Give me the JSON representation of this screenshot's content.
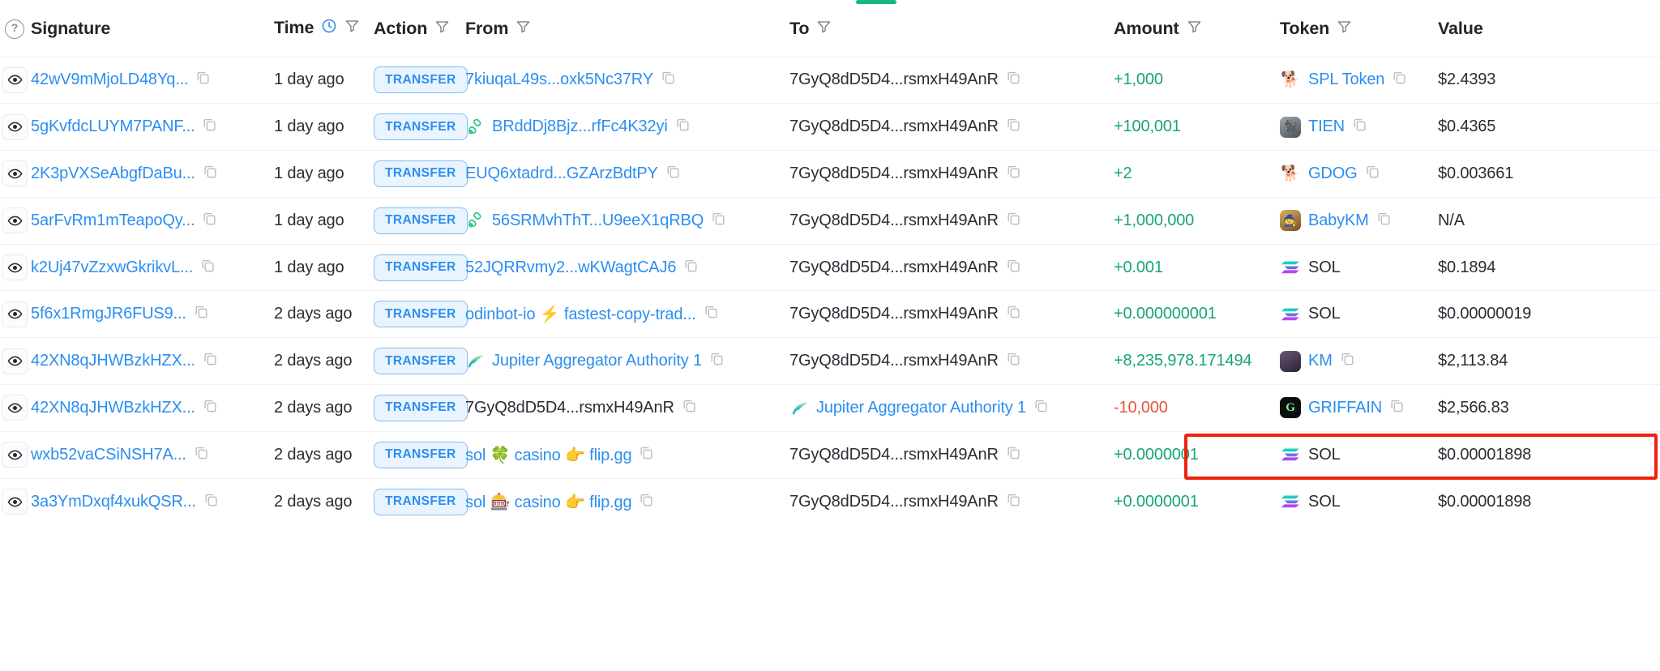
{
  "table": {
    "columns": [
      {
        "key": "eye",
        "label": "",
        "icon": "help-circle-icon",
        "filter": false
      },
      {
        "key": "signature",
        "label": "Signature",
        "filter": false
      },
      {
        "key": "time",
        "label": "Time",
        "icon": "clock-icon",
        "filter": true
      },
      {
        "key": "action",
        "label": "Action",
        "filter": true
      },
      {
        "key": "from",
        "label": "From",
        "filter": true
      },
      {
        "key": "to",
        "label": "To",
        "filter": true
      },
      {
        "key": "amount",
        "label": "Amount",
        "filter": true
      },
      {
        "key": "token",
        "label": "Token",
        "filter": true
      },
      {
        "key": "value",
        "label": "Value",
        "filter": false
      }
    ],
    "rows": [
      {
        "signature": "42wV9mMjoLD48Yq...",
        "time": "1 day ago",
        "action": "TRANSFER",
        "from": {
          "label": "7kiuqaL49s...oxk5Nc37RY",
          "link": true,
          "icon": "none",
          "copy": true
        },
        "to": {
          "label": "7GyQ8dD5D4...rsmxH49AnR",
          "link": false,
          "icon": "none",
          "copy": true
        },
        "amount": "+1,000",
        "amount_sign": "positive",
        "token": {
          "label": "SPL Token",
          "icon": "dog-emoji",
          "copy": true
        },
        "value": "$2.4393"
      },
      {
        "signature": "5gKvfdcLUYM7PANF...",
        "time": "1 day ago",
        "action": "TRANSFER",
        "from": {
          "label": "BRddDj8Bjz...rfFc4K32yi",
          "link": true,
          "icon": "pump-icon",
          "copy": true
        },
        "to": {
          "label": "7GyQ8dD5D4...rsmxH49AnR",
          "link": false,
          "icon": "none",
          "copy": true
        },
        "amount": "+100,001",
        "amount_sign": "positive",
        "token": {
          "label": "TIEN",
          "icon": "tien-avatar",
          "copy": true
        },
        "value": "$0.4365"
      },
      {
        "signature": "2K3pVXSeAbgfDaBu...",
        "time": "1 day ago",
        "action": "TRANSFER",
        "from": {
          "label": "EUQ6xtadrd...GZArzBdtPY",
          "link": true,
          "icon": "none",
          "copy": true
        },
        "to": {
          "label": "7GyQ8dD5D4...rsmxH49AnR",
          "link": false,
          "icon": "none",
          "copy": true
        },
        "amount": "+2",
        "amount_sign": "positive",
        "token": {
          "label": "GDOG",
          "icon": "puppy-emoji",
          "copy": true
        },
        "value": "$0.003661"
      },
      {
        "signature": "5arFvRm1mTeapoQy...",
        "time": "1 day ago",
        "action": "TRANSFER",
        "from": {
          "label": "56SRMvhThT...U9eeX1qRBQ",
          "link": true,
          "icon": "pump-icon",
          "copy": true
        },
        "to": {
          "label": "7GyQ8dD5D4...rsmxH49AnR",
          "link": false,
          "icon": "none",
          "copy": true
        },
        "amount": "+1,000,000",
        "amount_sign": "positive",
        "token": {
          "label": "BabyKM",
          "icon": "babykm-avatar",
          "copy": true
        },
        "value": "N/A"
      },
      {
        "signature": "k2Uj47vZzxwGkrikvL...",
        "time": "1 day ago",
        "action": "TRANSFER",
        "from": {
          "label": "52JQRRvmy2...wKWagtCAJ6",
          "link": true,
          "icon": "none",
          "copy": true
        },
        "to": {
          "label": "7GyQ8dD5D4...rsmxH49AnR",
          "link": false,
          "icon": "none",
          "copy": true
        },
        "amount": "+0.001",
        "amount_sign": "positive",
        "token": {
          "label": "SOL",
          "icon": "solana-logo",
          "copy": false
        },
        "value": "$0.1894"
      },
      {
        "signature": "5f6x1RmgJR6FUS9...",
        "time": "2 days ago",
        "action": "TRANSFER",
        "from": {
          "label": "odinbot-io ⚡ fastest-copy-trad...",
          "link": true,
          "icon": "none",
          "copy": true
        },
        "to": {
          "label": "7GyQ8dD5D4...rsmxH49AnR",
          "link": false,
          "icon": "none",
          "copy": true
        },
        "amount": "+0.000000001",
        "amount_sign": "positive",
        "token": {
          "label": "SOL",
          "icon": "solana-logo",
          "copy": false
        },
        "value": "$0.00000019"
      },
      {
        "signature": "42XN8qJHWBzkHZX...",
        "time": "2 days ago",
        "action": "TRANSFER",
        "from": {
          "label": "Jupiter Aggregator Authority 1",
          "link": true,
          "icon": "jupiter-logo",
          "copy": true
        },
        "to": {
          "label": "7GyQ8dD5D4...rsmxH49AnR",
          "link": false,
          "icon": "none",
          "copy": true
        },
        "amount": "+8,235,978.171494",
        "amount_sign": "positive",
        "token": {
          "label": "KM",
          "icon": "km-avatar",
          "copy": true
        },
        "value": "$2,113.84",
        "highlighted": true
      },
      {
        "signature": "42XN8qJHWBzkHZX...",
        "time": "2 days ago",
        "action": "TRANSFER",
        "from": {
          "label": "7GyQ8dD5D4...rsmxH49AnR",
          "link": false,
          "icon": "none",
          "copy": true
        },
        "to": {
          "label": "Jupiter Aggregator Authority 1",
          "link": true,
          "icon": "jupiter-logo",
          "copy": true
        },
        "amount": "-10,000",
        "amount_sign": "negative",
        "token": {
          "label": "GRIFFAIN",
          "icon": "griffain-avatar",
          "copy": true
        },
        "value": "$2,566.83"
      },
      {
        "signature": "wxb52vaCSiNSH7A...",
        "time": "2 days ago",
        "action": "TRANSFER",
        "from": {
          "label": "sol 🍀 casino 👉 flip.gg",
          "link": true,
          "icon": "none",
          "copy": true
        },
        "to": {
          "label": "7GyQ8dD5D4...rsmxH49AnR",
          "link": false,
          "icon": "none",
          "copy": true
        },
        "amount": "+0.0000001",
        "amount_sign": "positive",
        "token": {
          "label": "SOL",
          "icon": "solana-logo",
          "copy": false
        },
        "value": "$0.00001898"
      },
      {
        "signature": "3a3YmDxqf4xukQSR...",
        "time": "2 days ago",
        "action": "TRANSFER",
        "from": {
          "label": "sol 🎰 casino 👉 flip.gg",
          "link": true,
          "icon": "none",
          "copy": true
        },
        "to": {
          "label": "7GyQ8dD5D4...rsmxH49AnR",
          "link": false,
          "icon": "none",
          "copy": true
        },
        "amount": "+0.0000001",
        "amount_sign": "positive",
        "token": {
          "label": "SOL",
          "icon": "solana-logo",
          "copy": false
        },
        "value": "$0.00001898"
      }
    ]
  },
  "colors": {
    "link": "#2b8ef0",
    "positive": "#17a672",
    "negative": "#e5563a",
    "highlight_border": "#ef2211",
    "tab_indicator": "#12b981"
  }
}
